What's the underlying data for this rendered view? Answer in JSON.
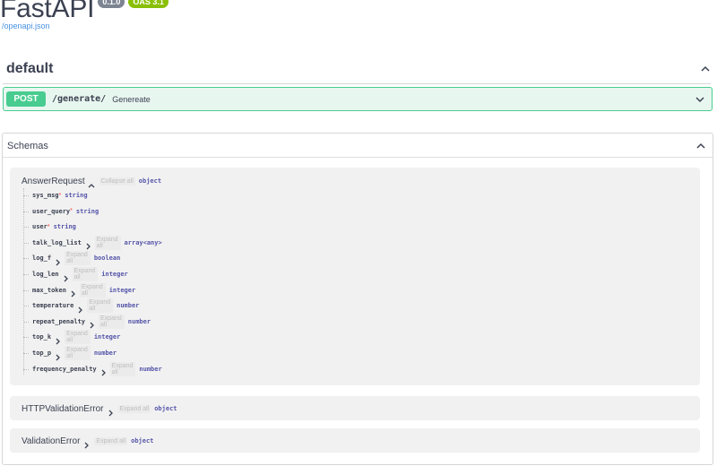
{
  "app": {
    "title": "FastAPI",
    "version_badge": "0.1.0",
    "oas_badge": "OAS 3.1",
    "openapi_link": "/openapi.json"
  },
  "default_section": {
    "title": "default"
  },
  "operation": {
    "method": "POST",
    "path": "/generate/",
    "summary": "Genereate"
  },
  "schemas": {
    "title": "Schemas",
    "answer_request": {
      "name": "AnswerRequest",
      "collapse_label": "Collapse all",
      "type": "object",
      "properties": [
        {
          "name": "sys_msg",
          "required": true,
          "type": "string",
          "expandable": false
        },
        {
          "name": "user_query",
          "required": true,
          "type": "string",
          "expandable": false
        },
        {
          "name": "user",
          "required": true,
          "type": "string",
          "expandable": false
        },
        {
          "name": "talk_log_list",
          "required": false,
          "type": "array<any>",
          "expandable": true,
          "expand_label": "Expand all"
        },
        {
          "name": "log_f",
          "required": false,
          "type": "boolean",
          "expandable": true,
          "expand_label": "Expand all"
        },
        {
          "name": "log_len",
          "required": false,
          "type": "integer",
          "expandable": true,
          "expand_label": "Expand all"
        },
        {
          "name": "max_token",
          "required": false,
          "type": "integer",
          "expandable": true,
          "expand_label": "Expand all"
        },
        {
          "name": "temperature",
          "required": false,
          "type": "number",
          "expandable": true,
          "expand_label": "Expand all"
        },
        {
          "name": "repeat_penalty",
          "required": false,
          "type": "number",
          "expandable": true,
          "expand_label": "Expand all"
        },
        {
          "name": "top_k",
          "required": false,
          "type": "integer",
          "expandable": true,
          "expand_label": "Expand all"
        },
        {
          "name": "top_p",
          "required": false,
          "type": "number",
          "expandable": true,
          "expand_label": "Expand all"
        },
        {
          "name": "frequency_penalty",
          "required": false,
          "type": "number",
          "expandable": true,
          "expand_label": "Expand all"
        }
      ]
    },
    "http_validation_error": {
      "name": "HTTPValidationError",
      "expand_label": "Expand all",
      "type": "object"
    },
    "validation_error": {
      "name": "ValidationError",
      "expand_label": "Expand all",
      "type": "object"
    }
  },
  "required_mark": "*",
  "colors": {
    "post_green": "#49cc90",
    "post_bg": "#e8f6f0",
    "link_blue": "#4990e2",
    "required_red": "#f93e3e"
  }
}
